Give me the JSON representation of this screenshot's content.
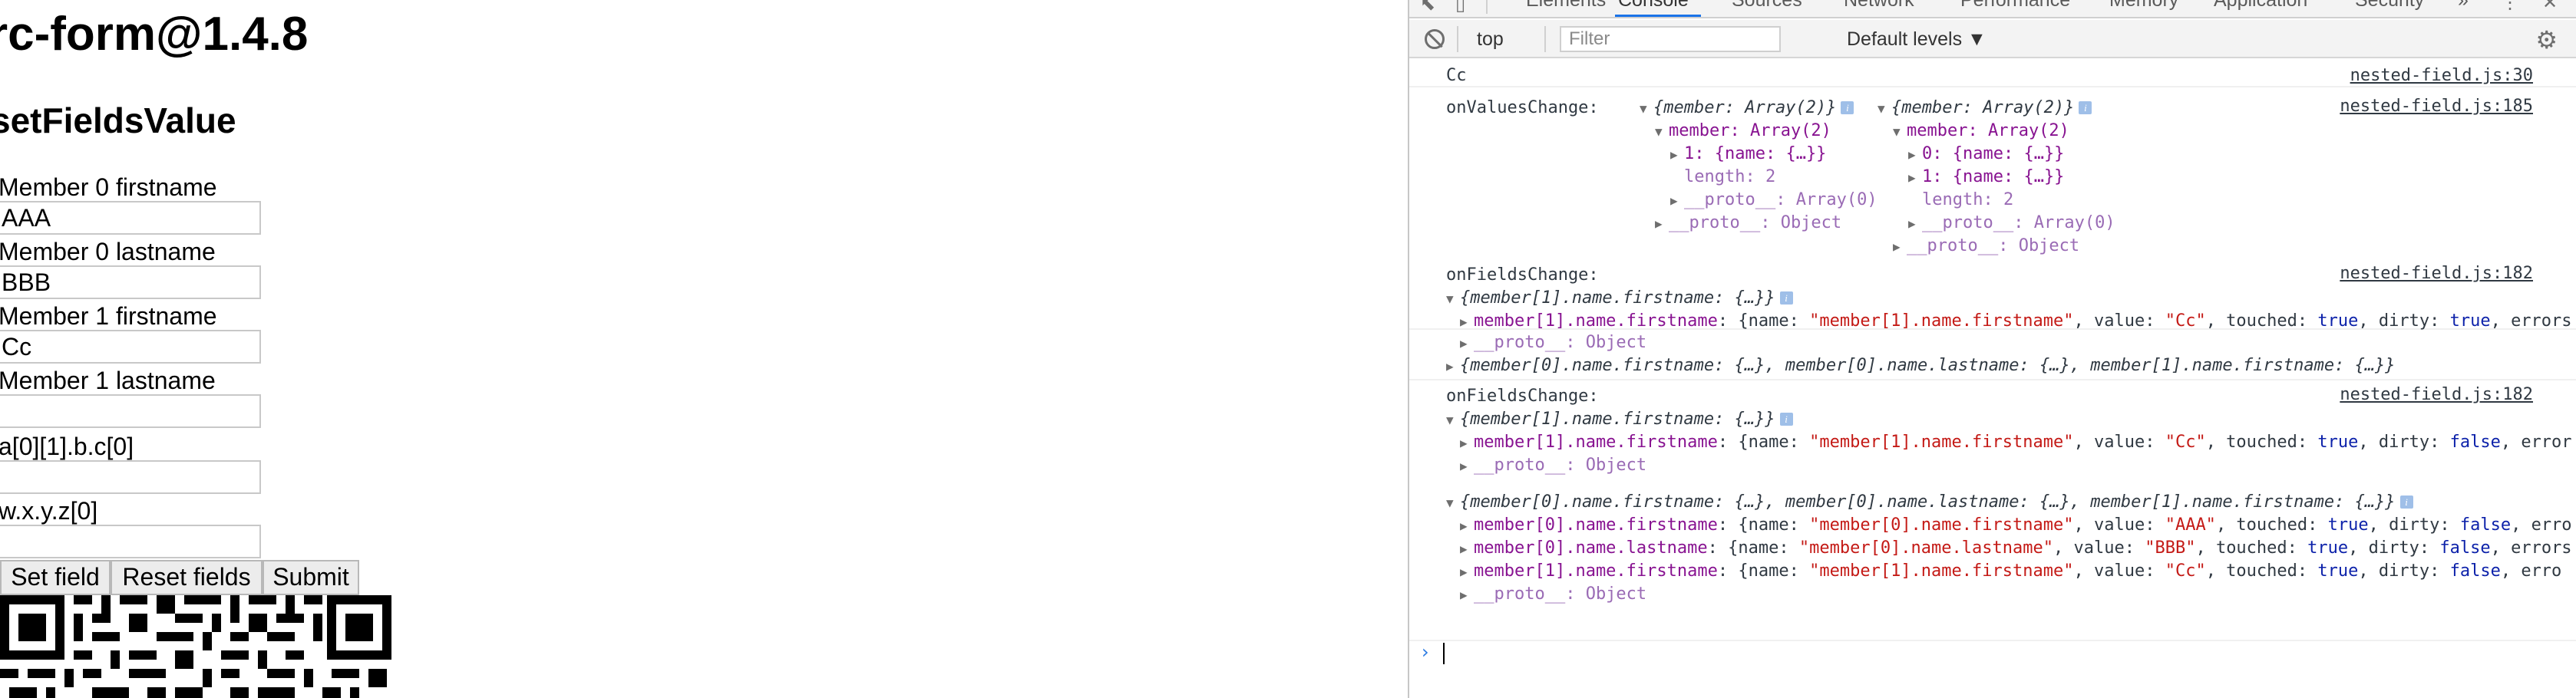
{
  "page": {
    "title": "rc-form@1.4.8",
    "subtitle": "setFieldsValue",
    "fields": [
      {
        "label": "Member 0 firstname",
        "value": "AAA"
      },
      {
        "label": "Member 0 lastname",
        "value": "BBB"
      },
      {
        "label": "Member 1 firstname",
        "value": "Cc"
      },
      {
        "label": "Member 1 lastname",
        "value": ""
      },
      {
        "label": "a[0][1].b.c[0]",
        "value": ""
      },
      {
        "label": "w.x.y.z[0]",
        "value": ""
      }
    ],
    "buttons": {
      "set_field": "Set field",
      "reset_fields": "Reset fields",
      "submit": "Submit"
    }
  },
  "devtools": {
    "tabs": [
      "Elements",
      "Console",
      "Sources",
      "Network",
      "Performance",
      "Memory",
      "Application",
      "Security"
    ],
    "active_tab": "Console",
    "more_tabs": "»",
    "context": "top",
    "filter_placeholder": "Filter",
    "levels": "Default levels ▼",
    "colors": {
      "accent": "#1a73e8",
      "key": "#881391",
      "string": "#c41a16",
      "number": "#1c00cf",
      "keyword": "#0d22aa"
    },
    "console": {
      "log1": {
        "text": "Cc",
        "source": "nested-field.js:30"
      },
      "values_change": {
        "label": "onValuesChange:",
        "source": "nested-field.js:185",
        "left": [
          "{member: Array(2)}",
          "member: Array(2)",
          "1: {name: {…}}",
          "length: 2",
          "__proto__: Array(0)",
          "__proto__: Object"
        ],
        "right": [
          "{member: Array(2)}",
          "member: Array(2)",
          "0: {name: {…}}",
          "1: {name: {…}}",
          "length: 2",
          "__proto__: Array(0)",
          "__proto__: Object"
        ]
      },
      "fields_change_1": {
        "label": "onFieldsChange:",
        "source": "nested-field.js:182",
        "summary": "{member[1].name.firstname: {…}}",
        "entry_key": "member[1].name.firstname",
        "entry_prefix": "{name: ",
        "entry_name": "\"member[1].name.firstname\"",
        "entry_mid1": ", value: ",
        "entry_value": "\"Cc\"",
        "entry_mid2": ", touched: ",
        "entry_touched": "true",
        "entry_mid3": ", dirty: ",
        "entry_dirty": "true",
        "entry_tail": ", errors",
        "proto": "__proto__: Object",
        "collapsed": "{member[0].name.firstname: {…}, member[0].name.lastname: {…}, member[1].name.firstname: {…}}"
      },
      "fields_change_2": {
        "label": "onFieldsChange:",
        "source": "nested-field.js:182",
        "summary": "{member[1].name.firstname: {…}}",
        "entry_key": "member[1].name.firstname",
        "entry_prefix": "{name: ",
        "entry_name": "\"member[1].name.firstname\"",
        "entry_mid1": ", value: ",
        "entry_value": "\"Cc\"",
        "entry_mid2": ", touched: ",
        "entry_touched": "true",
        "entry_mid3": ", dirty: ",
        "entry_dirty": "false",
        "entry_tail": ", error",
        "proto": "__proto__: Object",
        "summary2": "{member[0].name.firstname: {…}, member[0].name.lastname: {…}, member[1].name.firstname: {…}}",
        "entries": [
          {
            "key": "member[0].name.firstname",
            "name": "\"member[0].name.firstname\"",
            "value": "\"AAA\"",
            "touched": "true",
            "dirty": "false",
            "tail": ", erro"
          },
          {
            "key": "member[0].name.lastname",
            "name": "\"member[0].name.lastname\"",
            "value": "\"BBB\"",
            "touched": "true",
            "dirty": "false",
            "tail": ", errors"
          },
          {
            "key": "member[1].name.firstname",
            "name": "\"member[1].name.firstname\"",
            "value": "\"Cc\"",
            "touched": "true",
            "dirty": "false",
            "tail": ", erro"
          }
        ],
        "proto2": "__proto__: Object"
      },
      "prompt": "›"
    }
  }
}
